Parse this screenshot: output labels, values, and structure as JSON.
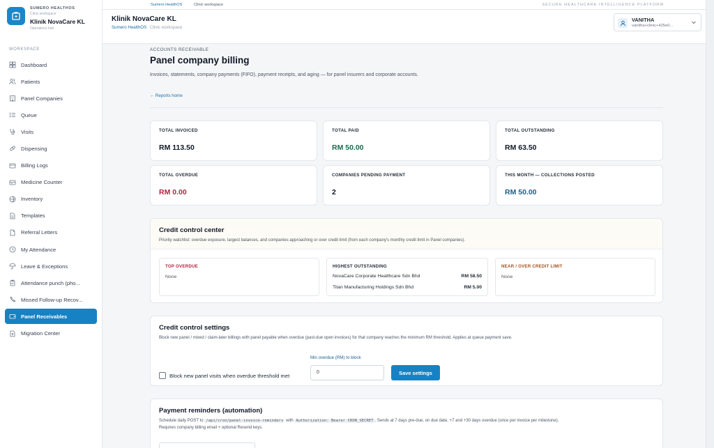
{
  "brand": {
    "org": "SUMERO HEALTHOS",
    "subtitle": "Clinic workspace",
    "clinic": "Klinik NovaCare KL",
    "hub": "Operations hub"
  },
  "sidebar": {
    "section_label": "WORKSPACE",
    "items": [
      {
        "label": "Dashboard",
        "icon": "grid-icon"
      },
      {
        "label": "Patients",
        "icon": "users-icon"
      },
      {
        "label": "Panel Companies",
        "icon": "building-icon"
      },
      {
        "label": "Queue",
        "icon": "list-icon"
      },
      {
        "label": "Visits",
        "icon": "stethoscope-icon"
      },
      {
        "label": "Dispensing",
        "icon": "pill-icon"
      },
      {
        "label": "Billing Logs",
        "icon": "credit-card-icon"
      },
      {
        "label": "Medicine Counter",
        "icon": "counter-icon"
      },
      {
        "label": "Inventory",
        "icon": "package-icon"
      },
      {
        "label": "Templates",
        "icon": "file-icon"
      },
      {
        "label": "Referral Letters",
        "icon": "document-icon"
      },
      {
        "label": "My Attendance",
        "icon": "clock-icon"
      },
      {
        "label": "Leave & Exceptions",
        "icon": "umbrella-icon"
      },
      {
        "label": "Attendance punch (pho...",
        "icon": "clipboard-icon"
      },
      {
        "label": "Missed Follow-up Recov...",
        "icon": "phone-icon"
      },
      {
        "label": "Panel Receivables",
        "icon": "wallet-icon",
        "active": true
      },
      {
        "label": "Migration Center",
        "icon": "upload-file-icon"
      }
    ]
  },
  "topbar": {
    "brand_link": "Sumero HealthOS",
    "workspace_link": "Clinic workspace",
    "secure_label": "SECURE HEALTHCARE INTELLIGENCE PLATFORM"
  },
  "header": {
    "title": "Klinik NovaCare KL",
    "crumb_brand": "Sumero HealthOS",
    "crumb_workspace": "Clinic workspace",
    "user_name": "VANITHA",
    "user_email": "vanitha+clinic+425e0..."
  },
  "page": {
    "eyebrow": "ACCOUNTS RECEIVABLE",
    "title": "Panel company billing",
    "description": "Invoices, statements, company payments (FIFO), payment receipts, and aging — for panel insurers and corporate accounts.",
    "back_link": "← Reports home"
  },
  "stats": [
    {
      "label": "TOTAL INVOICED",
      "value": "RM 113.50",
      "color": "#111827"
    },
    {
      "label": "TOTAL PAID",
      "value": "RM 50.00",
      "color": "#1d6b4a"
    },
    {
      "label": "TOTAL OUTSTANDING",
      "value": "RM 63.50",
      "color": "#111827"
    },
    {
      "label": "TOTAL OVERDUE",
      "value": "RM 0.00",
      "color": "#b3243f"
    },
    {
      "label": "COMPANIES PENDING PAYMENT",
      "value": "2",
      "color": "#111827"
    },
    {
      "label": "THIS MONTH — COLLECTIONS POSTED",
      "value": "RM 50.00",
      "color": "#1b5f8c"
    }
  ],
  "credit_center": {
    "title": "Credit control center",
    "description": "Priority watchlist: overdue exposure, largest balances, and companies approaching or over credit limit (from each company's monthly credit limit in Panel companies).",
    "top_overdue": {
      "title": "TOP OVERDUE",
      "empty": "None",
      "color": "#b3243f"
    },
    "highest_outstanding": {
      "title": "HIGHEST OUTSTANDING",
      "rows": [
        {
          "company": "NovaCare Corporate Healthcare Sdn Bhd",
          "amount": "RM 58.50"
        },
        {
          "company": "Titan Manufacturing Holdings Sdn Bhd",
          "amount": "RM 5.00"
        }
      ]
    },
    "near_limit": {
      "title": "NEAR / OVER CREDIT LIMIT",
      "empty": "None",
      "color": "#a4521c"
    }
  },
  "credit_settings": {
    "title": "Credit control settings",
    "description": "Block new panel / mixed / claim-later billings with panel payable when overdue (past-due open invoices) for that company reaches the minimum RM threshold. Applies at queue payment save.",
    "checkbox_label": "Block new panel visits when overdue threshold met",
    "checkbox_checked": false,
    "min_label": "Min overdue (RM) to block",
    "min_value": "0",
    "save_label": "Save settings"
  },
  "reminders": {
    "title": "Payment reminders (automation)",
    "desc_part1": "Schedule daily POST to",
    "code1": "/api/cron/panel-invoice-reminders",
    "desc_part2": "with",
    "code2": "Authorization: Bearer CRON_SECRET",
    "desc_part3": ". Sends at 7 days pre-due, on due date, +7 and +30 days overdue (once per invoice per milestone).",
    "desc_line2": "Requires company billing email + optional Resend keys."
  },
  "colors": {
    "accent": "#1682c4",
    "paid": "#1d6b4a",
    "overdue": "#b3243f",
    "collections": "#1b5f8c"
  }
}
